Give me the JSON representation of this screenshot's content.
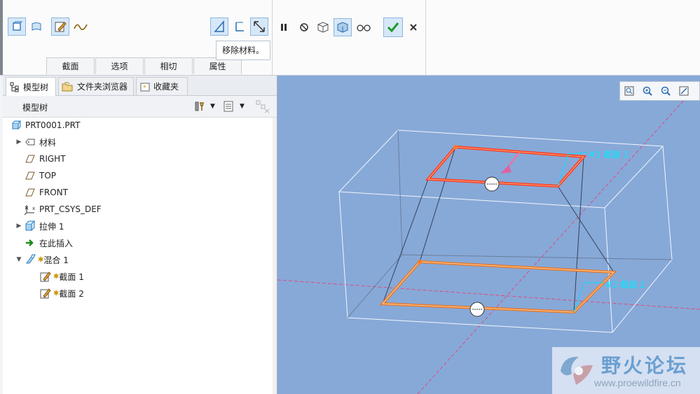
{
  "ribbon": {
    "tabs": [
      {
        "label": "截面"
      },
      {
        "label": "选项"
      },
      {
        "label": "相切"
      },
      {
        "label": "属性"
      }
    ],
    "tooltip": "移除材料。"
  },
  "model_panel": {
    "tabs": [
      {
        "label": "模型树"
      },
      {
        "label": "文件夹浏览器"
      },
      {
        "label": "收藏夹"
      }
    ],
    "tree_header": "模型树",
    "tree": [
      {
        "label": "PRT0001.PRT"
      },
      {
        "label": "材料"
      },
      {
        "label": "RIGHT"
      },
      {
        "label": "TOP"
      },
      {
        "label": "FRONT"
      },
      {
        "label": "PRT_CSYS_DEF"
      },
      {
        "label": "拉伸 1"
      },
      {
        "label": "在此插入"
      },
      {
        "label": "混合 1"
      },
      {
        "label": "截面 1"
      },
      {
        "label": "截面 2"
      }
    ]
  },
  "viewport": {
    "section_labels": [
      "#1 截面 1",
      "#2 截面 2"
    ]
  },
  "watermark": {
    "name": "野火论坛",
    "url": "www.proewildfire.cn"
  },
  "colors": {
    "viewport_bg": "#87a9d8",
    "section_edge": "#e87722",
    "selected_section": "#ff3a1a",
    "accent": "#3a87c8"
  }
}
